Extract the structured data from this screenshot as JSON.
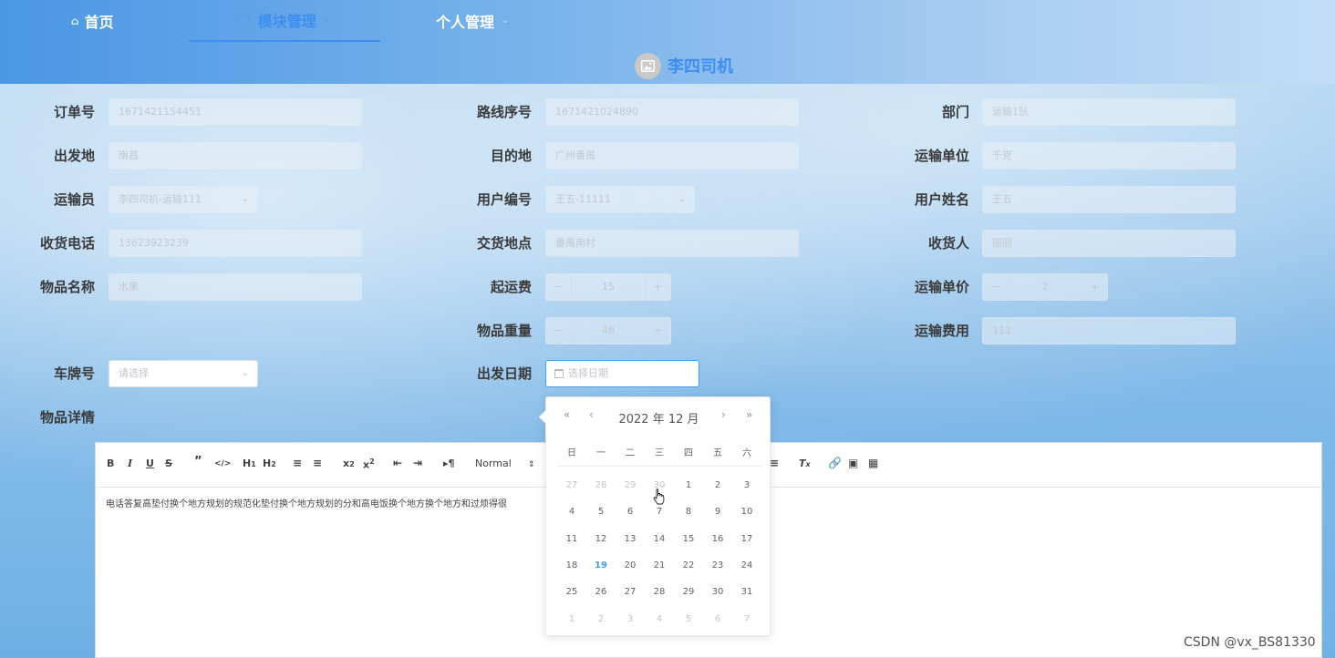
{
  "nav": {
    "home": "首页",
    "module": "模块管理",
    "personal": "个人管理",
    "user_name": "李四司机"
  },
  "form": {
    "order_no": {
      "label": "订单号",
      "value": "1671421154451"
    },
    "route_no": {
      "label": "路线序号",
      "value": "1671421024890"
    },
    "department": {
      "label": "部门",
      "value": "运输1队"
    },
    "origin": {
      "label": "出发地",
      "value": "南昌"
    },
    "destination": {
      "label": "目的地",
      "value": "广州番禺"
    },
    "transport_unit": {
      "label": "运输单位",
      "value": "千克"
    },
    "transporter": {
      "label": "运输员",
      "value": "李四司机-运输111"
    },
    "user_no": {
      "label": "用户编号",
      "value": "王五-11111"
    },
    "user_name": {
      "label": "用户姓名",
      "value": "王五"
    },
    "phone": {
      "label": "收货电话",
      "value": "13623923239"
    },
    "delivery_place": {
      "label": "交货地点",
      "value": "番禺南村"
    },
    "receiver": {
      "label": "收货人",
      "value": "丽丽"
    },
    "item_name": {
      "label": "物品名称",
      "value": "水果"
    },
    "start_fee": {
      "label": "起运费",
      "value": "15"
    },
    "unit_price": {
      "label": "运输单价",
      "value": "2"
    },
    "item_weight": {
      "label": "物品重量",
      "value": "48"
    },
    "transport_cost": {
      "label": "运输费用",
      "value": "111"
    },
    "plate_no": {
      "label": "车牌号",
      "placeholder": "请选择"
    },
    "depart_date": {
      "label": "出发日期",
      "placeholder": "选择日期"
    },
    "item_detail": {
      "label": "物品详情"
    }
  },
  "editor": {
    "header_select": "Normal",
    "content": "电话答复高垫付换个地方规划的规范化垫付换个地方规划的分和高电饭换个地方换个地方和过烦得很"
  },
  "datepicker": {
    "title": "2022 年  12 月",
    "weekdays": [
      "日",
      "一",
      "二",
      "三",
      "四",
      "五",
      "六"
    ],
    "rows": [
      [
        {
          "d": "27",
          "o": true
        },
        {
          "d": "28",
          "o": true
        },
        {
          "d": "29",
          "o": true
        },
        {
          "d": "30",
          "o": true
        },
        {
          "d": "1"
        },
        {
          "d": "2"
        },
        {
          "d": "3"
        }
      ],
      [
        {
          "d": "4"
        },
        {
          "d": "5"
        },
        {
          "d": "6"
        },
        {
          "d": "7"
        },
        {
          "d": "8"
        },
        {
          "d": "9"
        },
        {
          "d": "10"
        }
      ],
      [
        {
          "d": "11"
        },
        {
          "d": "12"
        },
        {
          "d": "13"
        },
        {
          "d": "14"
        },
        {
          "d": "15"
        },
        {
          "d": "16"
        },
        {
          "d": "17"
        }
      ],
      [
        {
          "d": "18"
        },
        {
          "d": "19",
          "t": true
        },
        {
          "d": "20"
        },
        {
          "d": "21"
        },
        {
          "d": "22"
        },
        {
          "d": "23"
        },
        {
          "d": "24"
        }
      ],
      [
        {
          "d": "25"
        },
        {
          "d": "26"
        },
        {
          "d": "27"
        },
        {
          "d": "28"
        },
        {
          "d": "29"
        },
        {
          "d": "30"
        },
        {
          "d": "31"
        }
      ],
      [
        {
          "d": "1",
          "o": true
        },
        {
          "d": "2",
          "o": true
        },
        {
          "d": "3",
          "o": true
        },
        {
          "d": "4",
          "o": true
        },
        {
          "d": "5",
          "o": true
        },
        {
          "d": "6",
          "o": true
        },
        {
          "d": "7",
          "o": true
        }
      ]
    ]
  },
  "colors": {
    "accent": "#409eff",
    "nav_active": "#3d8ef0"
  },
  "watermark": "CSDN @vx_BS81330"
}
